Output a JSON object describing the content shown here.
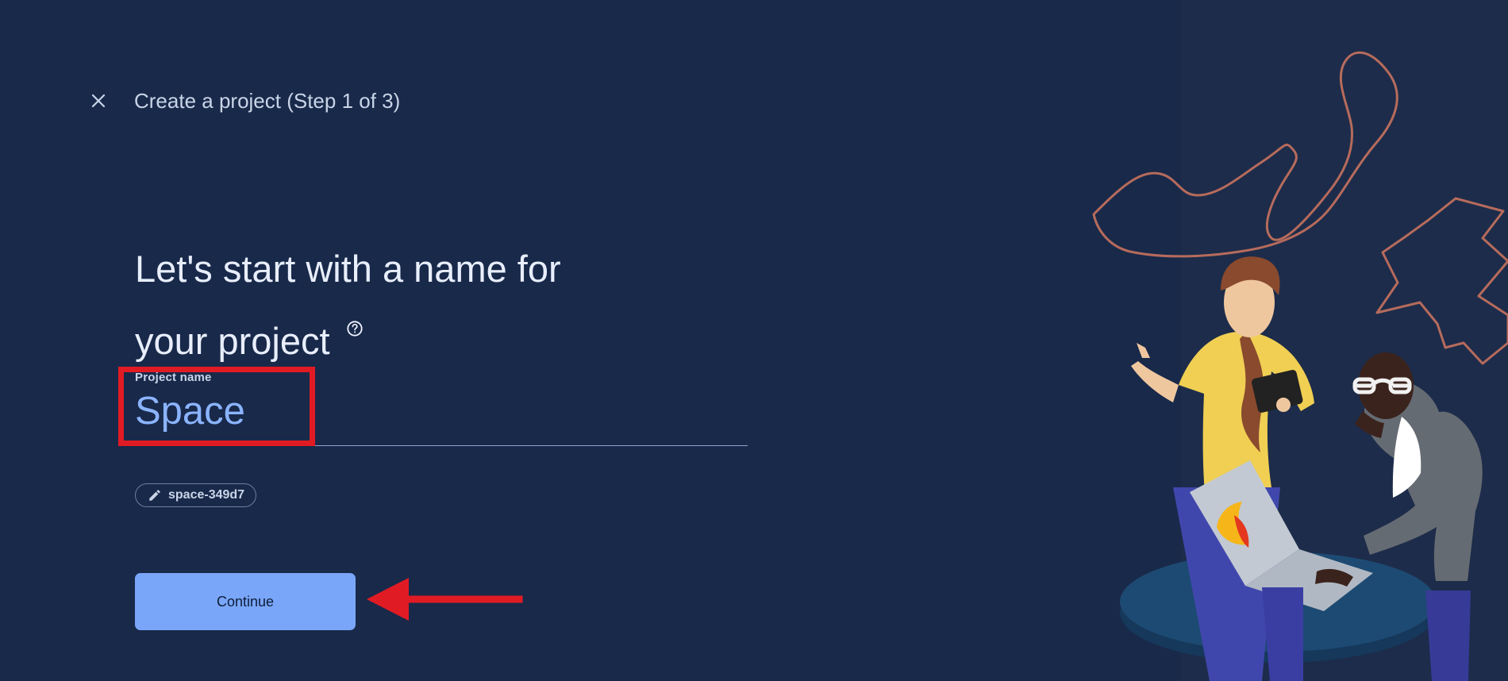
{
  "header": {
    "title": "Create a project (Step 1 of 3)",
    "close_icon": "close-icon"
  },
  "main": {
    "headline_line1": "Let's start with a name for",
    "headline_line2": "your project",
    "help_icon": "help-circle-icon",
    "project_field": {
      "label": "Project name",
      "value": "Space",
      "placeholder": ""
    },
    "project_id_chip": {
      "icon": "pencil-icon",
      "label": "space-349d7"
    },
    "continue_label": "Continue"
  },
  "annotations": {
    "highlight_color": "#e11b24",
    "arrow_color": "#e11b24"
  },
  "theme": {
    "background": "#19294a",
    "right_panel": "#1d2c4a",
    "primary_text": "#e8eefb",
    "secondary_text": "#c9d4e7",
    "accent": "#7aa6f9",
    "input_text": "#8bb4ff"
  }
}
